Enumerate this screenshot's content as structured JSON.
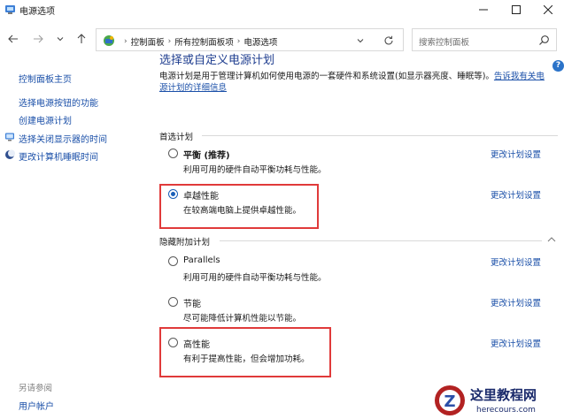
{
  "window": {
    "title": "电源选项"
  },
  "nav": {
    "breadcrumbs": [
      "控制面板",
      "所有控制面板项",
      "电源选项"
    ],
    "search_placeholder": "搜索控制面板"
  },
  "sidebar": {
    "home": "控制面板主页",
    "items": [
      {
        "label": "选择电源按钮的功能",
        "icon": ""
      },
      {
        "label": "创建电源计划",
        "icon": ""
      },
      {
        "label": "选择关闭显示器的时间",
        "icon": "monitor-icon"
      },
      {
        "label": "更改计算机睡眠时间",
        "icon": "moon-icon"
      }
    ],
    "see_also_label": "另请参阅",
    "see_also_items": [
      "用户帐户"
    ]
  },
  "main": {
    "title": "选择或自定义电源计划",
    "description": "电源计划是用于管理计算机如何使用电源的一套硬件和系统设置(如显示器亮度、睡眠等)。",
    "description_link_a": "告诉我有关电",
    "description_link_b": "源计划的详细信息",
    "preferred_label": "首选计划",
    "hidden_label": "隐藏附加计划",
    "change_link": "更改计划设置",
    "preferred_plans": [
      {
        "name": "平衡 (推荐)",
        "desc": "利用可用的硬件自动平衡功耗与性能。",
        "selected": false
      },
      {
        "name": "卓越性能",
        "desc": "在较高端电脑上提供卓越性能。",
        "selected": true
      }
    ],
    "hidden_plans": [
      {
        "name": "Parallels",
        "desc": "利用可用的硬件自动平衡功耗与性能。",
        "selected": false
      },
      {
        "name": "节能",
        "desc": "尽可能降低计算机性能以节能。",
        "selected": false
      },
      {
        "name": "高性能",
        "desc": "有利于提高性能，但会增加功耗。",
        "selected": false
      }
    ]
  },
  "help": {
    "glyph": "?"
  },
  "watermark": {
    "brand": "这里教程网",
    "domain": "herecours.com",
    "letter": "Z"
  },
  "colors": {
    "link": "#1a4fa8",
    "title": "#1e3d8f",
    "highlight_box": "#e03a3a",
    "radio_selected": "#1a5fb8"
  }
}
